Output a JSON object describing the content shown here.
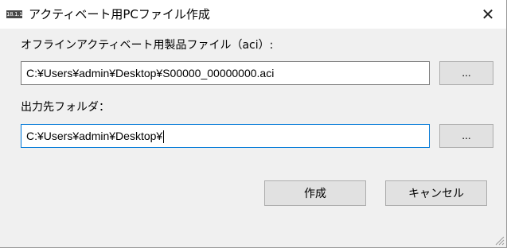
{
  "window": {
    "icon_text": "18.1.1",
    "title": "アクティベート用PCファイル作成",
    "close_glyph": "✕"
  },
  "form": {
    "aci_label": "オフラインアクティベート用製品ファイル（aci）:",
    "aci_path": "C:¥Users¥admin¥Desktop¥S00000_00000000.aci",
    "aci_browse": "...",
    "output_label": "出力先フォルダ：",
    "output_path": "C:¥Users¥admin¥Desktop¥",
    "output_browse": "..."
  },
  "buttons": {
    "create": "作成",
    "cancel": "キャンセル"
  }
}
